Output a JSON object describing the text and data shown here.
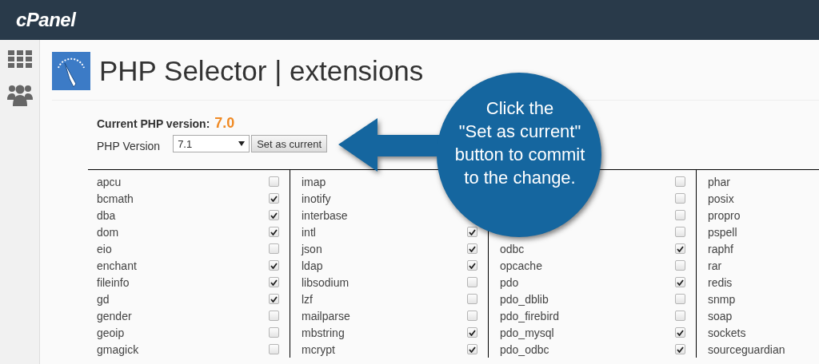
{
  "topbar": {
    "logo": "cPanel"
  },
  "page": {
    "title": "PHP Selector | extensions"
  },
  "current_version": {
    "label": "Current PHP version:",
    "value": "7.0"
  },
  "version_form": {
    "label": "PHP Version",
    "select_value": "7.1",
    "button": "Set as current"
  },
  "extension_columns": [
    {
      "items": [
        {
          "name": "apcu",
          "checked": false
        },
        {
          "name": "bcmath",
          "checked": true
        },
        {
          "name": "dba",
          "checked": true
        },
        {
          "name": "dom",
          "checked": true
        },
        {
          "name": "eio",
          "checked": false
        },
        {
          "name": "enchant",
          "checked": true
        },
        {
          "name": "fileinfo",
          "checked": true
        },
        {
          "name": "gd",
          "checked": true
        },
        {
          "name": "gender",
          "checked": false
        },
        {
          "name": "geoip",
          "checked": false
        },
        {
          "name": "gmagick",
          "checked": false
        }
      ]
    },
    {
      "items": [
        {
          "name": "imap"
        },
        {
          "name": "inotify"
        },
        {
          "name": "interbase"
        },
        {
          "name": "intl",
          "checked": true
        },
        {
          "name": "json",
          "checked": true
        },
        {
          "name": "ldap",
          "checked": true
        },
        {
          "name": "libsodium",
          "checked": false
        },
        {
          "name": "lzf",
          "checked": false
        },
        {
          "name": "mailparse",
          "checked": false
        },
        {
          "name": "mbstring",
          "checked": true
        },
        {
          "name": "mcrypt",
          "checked": true
        }
      ]
    },
    {
      "items": [
        {
          "checked": false
        },
        {
          "checked": false
        },
        {
          "checked": false
        },
        {
          "checked": false
        },
        {
          "name": "odbc",
          "checked": true
        },
        {
          "name": "opcache",
          "checked": false
        },
        {
          "name": "pdo",
          "checked": true
        },
        {
          "name": "pdo_dblib",
          "checked": false
        },
        {
          "name": "pdo_firebird",
          "checked": false
        },
        {
          "name": "pdo_mysql",
          "checked": true
        },
        {
          "name": "pdo_odbc",
          "checked": true
        }
      ]
    },
    {
      "items": [
        {
          "name": "phar"
        },
        {
          "name": "posix"
        },
        {
          "name": "propro"
        },
        {
          "name": "pspell"
        },
        {
          "name": "raphf"
        },
        {
          "name": "rar"
        },
        {
          "name": "redis"
        },
        {
          "name": "snmp"
        },
        {
          "name": "soap"
        },
        {
          "name": "sockets"
        },
        {
          "name": "sourceguardian"
        }
      ]
    }
  ],
  "callout": {
    "text": "Click the\n\"Set as current\"\nbutton to commit\nto the change."
  }
}
